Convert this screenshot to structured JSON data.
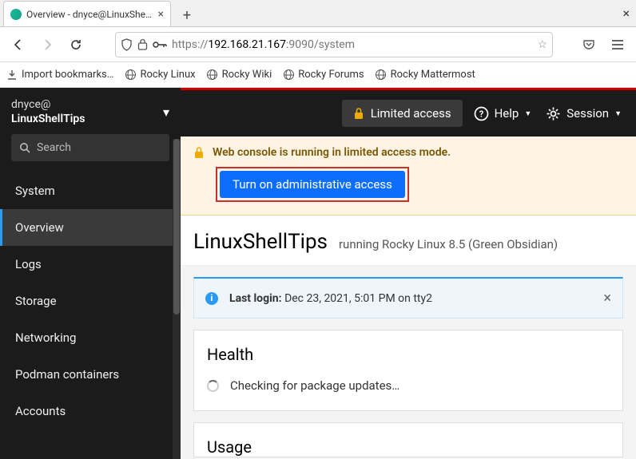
{
  "browser": {
    "tab_title": "Overview - dnyce@LinuxShellTips",
    "url_scheme": "https://",
    "url_host": "192.168.21.167",
    "url_path": ":9090/system",
    "bookmarks": {
      "import": "Import bookmarks…",
      "rocky_linux": "Rocky Linux",
      "rocky_wiki": "Rocky Wiki",
      "rocky_forums": "Rocky Forums",
      "rocky_mattermost": "Rocky Mattermost"
    }
  },
  "sidebar": {
    "user": "dnyce@",
    "host": "LinuxShellTips",
    "search_placeholder": "Search",
    "items": [
      {
        "label": "System"
      },
      {
        "label": "Overview"
      },
      {
        "label": "Logs"
      },
      {
        "label": "Storage"
      },
      {
        "label": "Networking"
      },
      {
        "label": "Podman containers"
      },
      {
        "label": "Accounts"
      }
    ]
  },
  "topbar": {
    "limited": "Limited access",
    "help": "Help",
    "session": "Session"
  },
  "alert": {
    "text": "Web console is running in limited access mode.",
    "button": "Turn on administrative access"
  },
  "page": {
    "hostname": "LinuxShellTips",
    "subtitle": "running Rocky Linux 8.5 (Green Obsidian)"
  },
  "last_login": {
    "label": "Last login: ",
    "value": "Dec 23, 2021, 5:01 PM on tty2"
  },
  "health": {
    "title": "Health",
    "checking": "Checking for package updates…"
  },
  "usage": {
    "title": "Usage"
  }
}
